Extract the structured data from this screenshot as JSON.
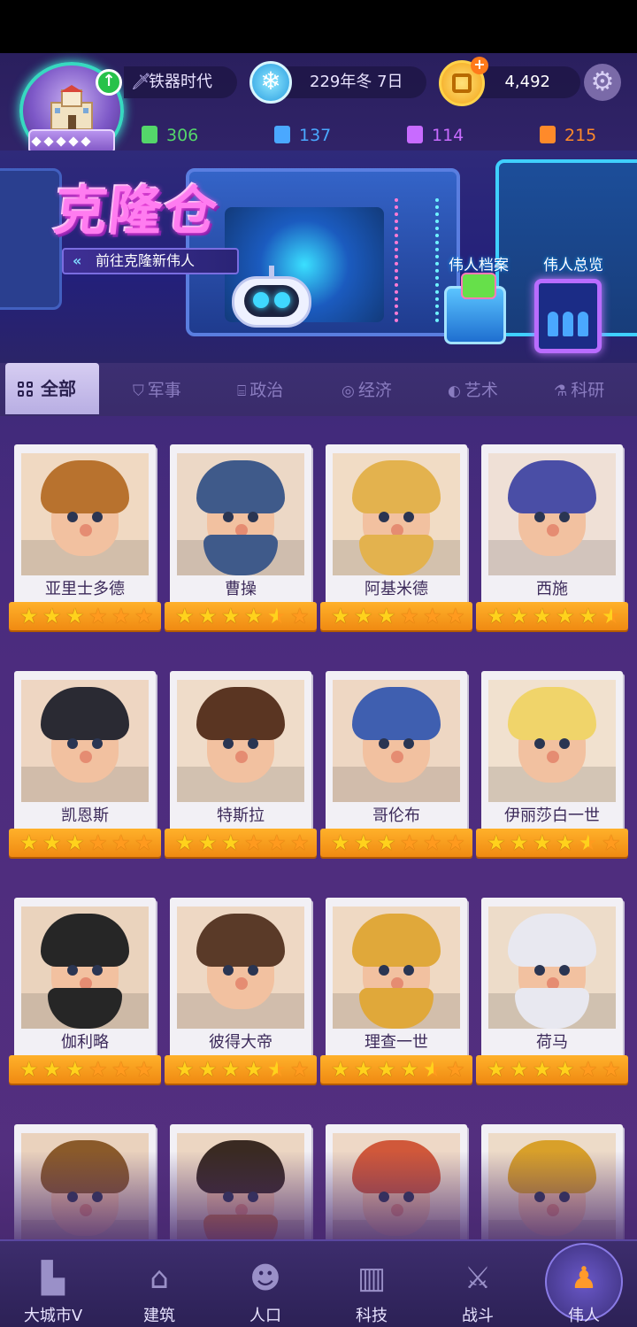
{
  "header": {
    "era": "铁器时代",
    "date": "229年冬 7日",
    "gold": "4,492",
    "resources": [
      {
        "value": "306",
        "color": "#54d66a"
      },
      {
        "value": "137",
        "color": "#4aa8ff"
      },
      {
        "value": "114",
        "color": "#c86bff"
      },
      {
        "value": "215",
        "color": "#ff8a2a"
      }
    ]
  },
  "banner": {
    "title": "克隆仓",
    "link": "前往克隆新伟人",
    "archive": "伟人档案",
    "overview": "伟人总览"
  },
  "tabs": {
    "all": "全部",
    "items": [
      "军事",
      "政治",
      "经济",
      "艺术",
      "科研"
    ]
  },
  "cards": [
    {
      "name": "亚里士多德",
      "stars": 3,
      "hair": "#b8722e",
      "beard": "",
      "bg": "#f0d9c2"
    },
    {
      "name": "曹操",
      "stars": 4.5,
      "hair": "#3f5a8a",
      "beard": "#3f5a8a",
      "bg": "#ecd8c6"
    },
    {
      "name": "阿基米德",
      "stars": 3,
      "hair": "#e3b24e",
      "beard": "#e3b24e",
      "bg": "#f1dcc5"
    },
    {
      "name": "西施",
      "stars": 5.5,
      "hair": "#4a4ea6",
      "beard": "",
      "bg": "#efe0d6"
    },
    {
      "name": "凯恩斯",
      "stars": 3,
      "hair": "#2a2a33",
      "beard": "",
      "bg": "#eed6c2"
    },
    {
      "name": "特斯拉",
      "stars": 3,
      "hair": "#5a3522",
      "beard": "",
      "bg": "#efdcc9"
    },
    {
      "name": "哥伦布",
      "stars": 3,
      "hair": "#3f5fb0",
      "beard": "",
      "bg": "#eed7c3"
    },
    {
      "name": "伊丽莎白一世",
      "stars": 4.5,
      "hair": "#f0d46a",
      "beard": "",
      "bg": "#f1e1cf"
    },
    {
      "name": "伽利略",
      "stars": 3,
      "hair": "#262626",
      "beard": "#262626",
      "bg": "#ead3bd"
    },
    {
      "name": "彼得大帝",
      "stars": 4.5,
      "hair": "#5a3a28",
      "beard": "",
      "bg": "#eed8c4"
    },
    {
      "name": "理查一世",
      "stars": 4.5,
      "hair": "#e0a83a",
      "beard": "#e0a83a",
      "bg": "#efd9c3"
    },
    {
      "name": "荷马",
      "stars": 4,
      "hair": "#e8e8f0",
      "beard": "#e8e8f0",
      "bg": "#eddcc9"
    },
    {
      "name": "",
      "stars": 0,
      "hair": "#8a5a2a",
      "beard": "",
      "bg": "#ead2bd"
    },
    {
      "name": "",
      "stars": 0,
      "hair": "#3a2a22",
      "beard": "#d27a3a",
      "bg": "#ecd6c2"
    },
    {
      "name": "",
      "stars": 0,
      "hair": "#d0583a",
      "beard": "",
      "bg": "#eed8c6"
    },
    {
      "name": "",
      "stars": 0,
      "hair": "#d8a02a",
      "beard": "",
      "bg": "#eddbc8"
    }
  ],
  "nav": [
    {
      "label": "大城市V",
      "icon": "castle-icon",
      "glyph": "▙"
    },
    {
      "label": "建筑",
      "icon": "house-icon",
      "glyph": "⌂"
    },
    {
      "label": "人口",
      "icon": "person-icon",
      "glyph": "☻"
    },
    {
      "label": "科技",
      "icon": "book-icon",
      "glyph": "▥"
    },
    {
      "label": "战斗",
      "icon": "crossed-swords-icon",
      "glyph": "⚔"
    },
    {
      "label": "伟人",
      "icon": "great-person-icon",
      "glyph": "♟"
    }
  ]
}
